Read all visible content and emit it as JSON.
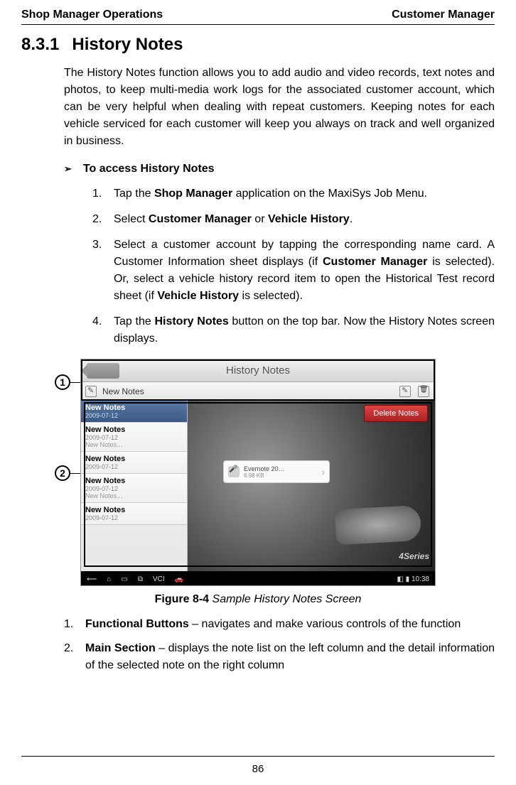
{
  "header": {
    "left": "Shop Manager Operations",
    "right": "Customer Manager"
  },
  "section": {
    "number": "8.3.1",
    "title": "History Notes"
  },
  "intro": "The History Notes function allows you to add audio and video records, text notes and photos, to keep multi-media work logs for the associated customer account, which can be very helpful when dealing with repeat customers. Keeping notes for each vehicle serviced for each customer will keep you always on track and well organized in business.",
  "procedure": {
    "title": "To access History Notes"
  },
  "steps": [
    {
      "num": "1.",
      "pre": "Tap the ",
      "b1": "Shop Manager",
      "post": " application on the MaxiSys Job Menu."
    },
    {
      "num": "2.",
      "pre": "Select ",
      "b1": "Customer Manager",
      "mid": " or ",
      "b2": "Vehicle History",
      "post": "."
    },
    {
      "num": "3.",
      "pre": "Select a customer account by tapping the corresponding name card. A Customer Information sheet displays (if ",
      "b1": "Customer Manager",
      "mid": " is selected). Or, select a vehicle history record item to open the Historical Test record sheet (if ",
      "b2": "Vehicle History",
      "post": " is selected)."
    },
    {
      "num": "4.",
      "pre": "Tap the ",
      "b1": "History Notes",
      "post": " button on the top bar. Now the History Notes screen displays."
    }
  ],
  "callouts": {
    "c1": "1",
    "c2": "2"
  },
  "screenshot": {
    "title": "History Notes",
    "toolbar_selected": "New Notes",
    "preview_text": "New Notes…",
    "delete_btn": "Delete Notes",
    "attachment": {
      "name": "Evernote 20…",
      "size": "6.98 KB"
    },
    "car_badge": "4Series",
    "time": "10:38",
    "notes": [
      {
        "title": "New Notes",
        "date": "2009-07-12",
        "sub": "",
        "selected": true
      },
      {
        "title": "New Notes",
        "date": "2009-07-12",
        "sub": "New Notes…",
        "selected": false
      },
      {
        "title": "New Notes",
        "date": "2009-07-12",
        "sub": "",
        "selected": false
      },
      {
        "title": "New Notes",
        "date": "2009-07-12",
        "sub": "New Notes…",
        "selected": false
      },
      {
        "title": "New Notes",
        "date": "2009-07-12",
        "sub": "",
        "selected": false
      }
    ]
  },
  "figure": {
    "number": "Figure 8-4",
    "title": " Sample History Notes Screen"
  },
  "legend": [
    {
      "num": "1.",
      "b": "Functional Buttons",
      "rest": " – navigates and make various controls of the function"
    },
    {
      "num": "2.",
      "b": "Main Section",
      "rest": " – displays the note list on the left column and the detail information of the selected note on the right column"
    }
  ],
  "page_number": "86"
}
